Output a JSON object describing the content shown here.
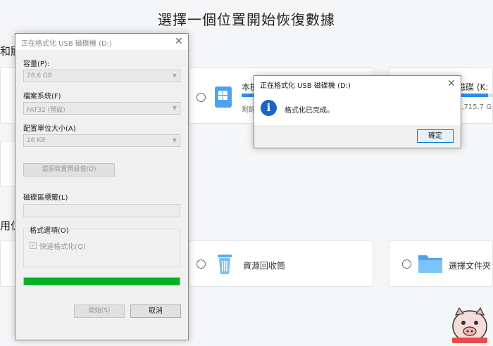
{
  "background": {
    "title": "選擇一個位置開始恢復數據",
    "left_label_1": "和顯",
    "left_label_2": "用位",
    "cards": {
      "local_disk": {
        "label": "本機",
        "sub": "剩餘"
      },
      "right_disk": {
        "label": "磁碟 (K:",
        "sub": "7,715.7 G"
      },
      "recycle_bin": {
        "label": "資源回收筒"
      },
      "choose_folder": {
        "label": "選擇文件夾"
      }
    }
  },
  "format_dialog": {
    "title": "正在格式化 USB 磁碟機 (D:)",
    "capacity_label": "容量(P):",
    "capacity_value": "28.6 GB",
    "filesystem_label": "檔案系統(F)",
    "filesystem_value": "FAT32 (預設)",
    "allocation_label": "配置單位大小(A)",
    "allocation_value": "16 KB",
    "restore_defaults_label": "還原裝置預設值(D)",
    "volume_label_label": "磁碟區標籤(L)",
    "volume_label_value": "",
    "options_legend": "格式選項(O)",
    "quick_format_label": "快速格式化(Q)",
    "progress": 1.0,
    "start_label": "開始(S)",
    "cancel_label": "取消"
  },
  "message_box": {
    "title": "正在格式化 USB 磁碟機 (D:)",
    "text": "格式化已完成。",
    "ok_label": "確定"
  },
  "colors": {
    "accent": "#2d8cf0",
    "progress_green": "#06b025",
    "info_blue": "#1a66c8"
  }
}
